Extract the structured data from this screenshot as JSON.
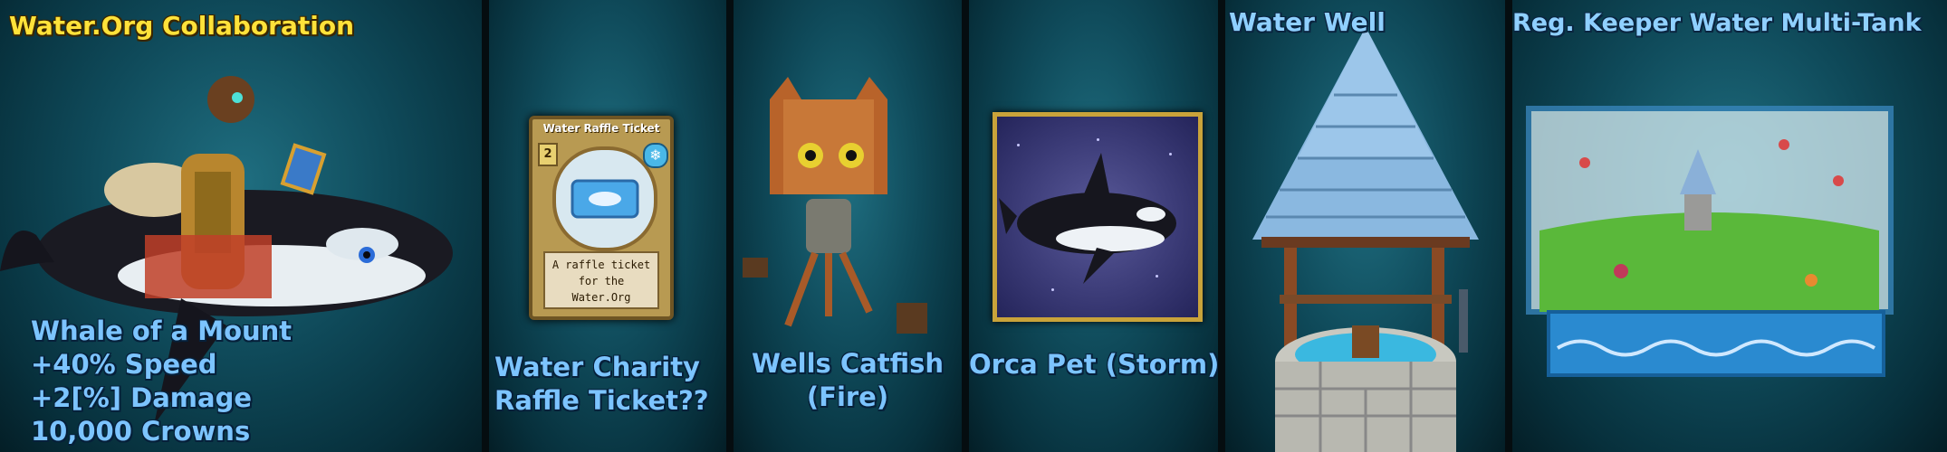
{
  "banner_title": "Water.Org Collaboration",
  "panels": [
    {
      "key": "whale",
      "caption_lines": [
        "Whale of a Mount",
        "+40% Speed",
        "+2[%] Damage",
        "10,000 Crowns"
      ]
    },
    {
      "key": "raffle",
      "caption_lines": [
        "Water Charity",
        "Raffle Ticket??"
      ],
      "card": {
        "title": "Water Raffle Ticket",
        "pips": "2",
        "text_lines": [
          "A raffle ticket",
          "for the",
          "Water.Org"
        ],
        "school_icon": "snowflake-icon"
      }
    },
    {
      "key": "catfish",
      "caption_lines": [
        "Wells Catfish",
        "(Fire)"
      ]
    },
    {
      "key": "orca",
      "caption_lines": [
        "Orca Pet (Storm)"
      ]
    },
    {
      "key": "well",
      "title": "Water Well"
    },
    {
      "key": "tank",
      "title": "Reg. Keeper Water Multi-Tank"
    }
  ],
  "colors": {
    "title_yellow": "#ffe23a",
    "caption_blue": "#7cc4ff",
    "title_blue": "#8fd0ff",
    "panel_bg": "#0f4a5a",
    "frame_gold": "#c9a33a"
  }
}
